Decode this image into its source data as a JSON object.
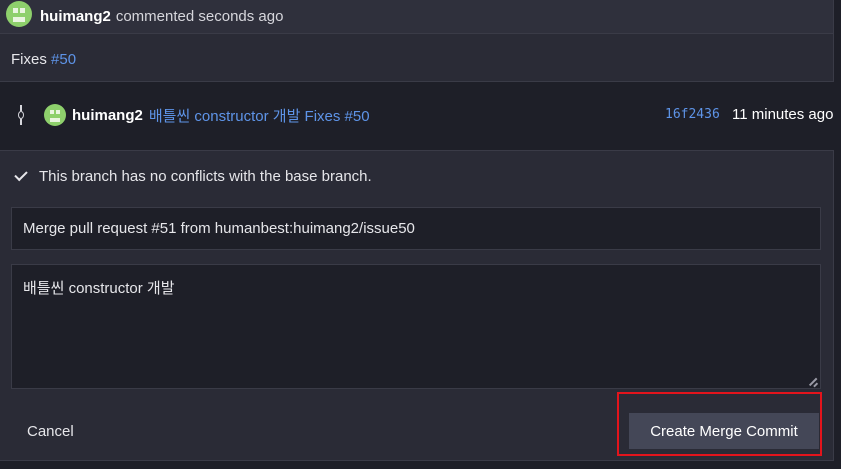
{
  "comment": {
    "author": "huimang2",
    "action": "commented seconds ago",
    "body_text": "Fixes",
    "body_link": "#50"
  },
  "commit": {
    "author": "huimang2",
    "message": "배틀씬 constructor 개발 Fixes #50",
    "sha": "16f2436",
    "time": "11 minutes ago"
  },
  "merge": {
    "status": "This branch has no conflicts with the base branch.",
    "title_value": "Merge pull request #51 from humanbest:huimang2/issue50",
    "body_value": "배틀씬 constructor 개발",
    "cancel_label": "Cancel",
    "create_label": "Create Merge Commit"
  },
  "colors": {
    "accent_link": "#5e94e8",
    "highlight_border": "#e3141c",
    "avatar": "#8ed06c"
  },
  "icons": [
    "avatar-identicon",
    "git-commit-icon",
    "check-icon",
    "resize-handle-icon"
  ]
}
